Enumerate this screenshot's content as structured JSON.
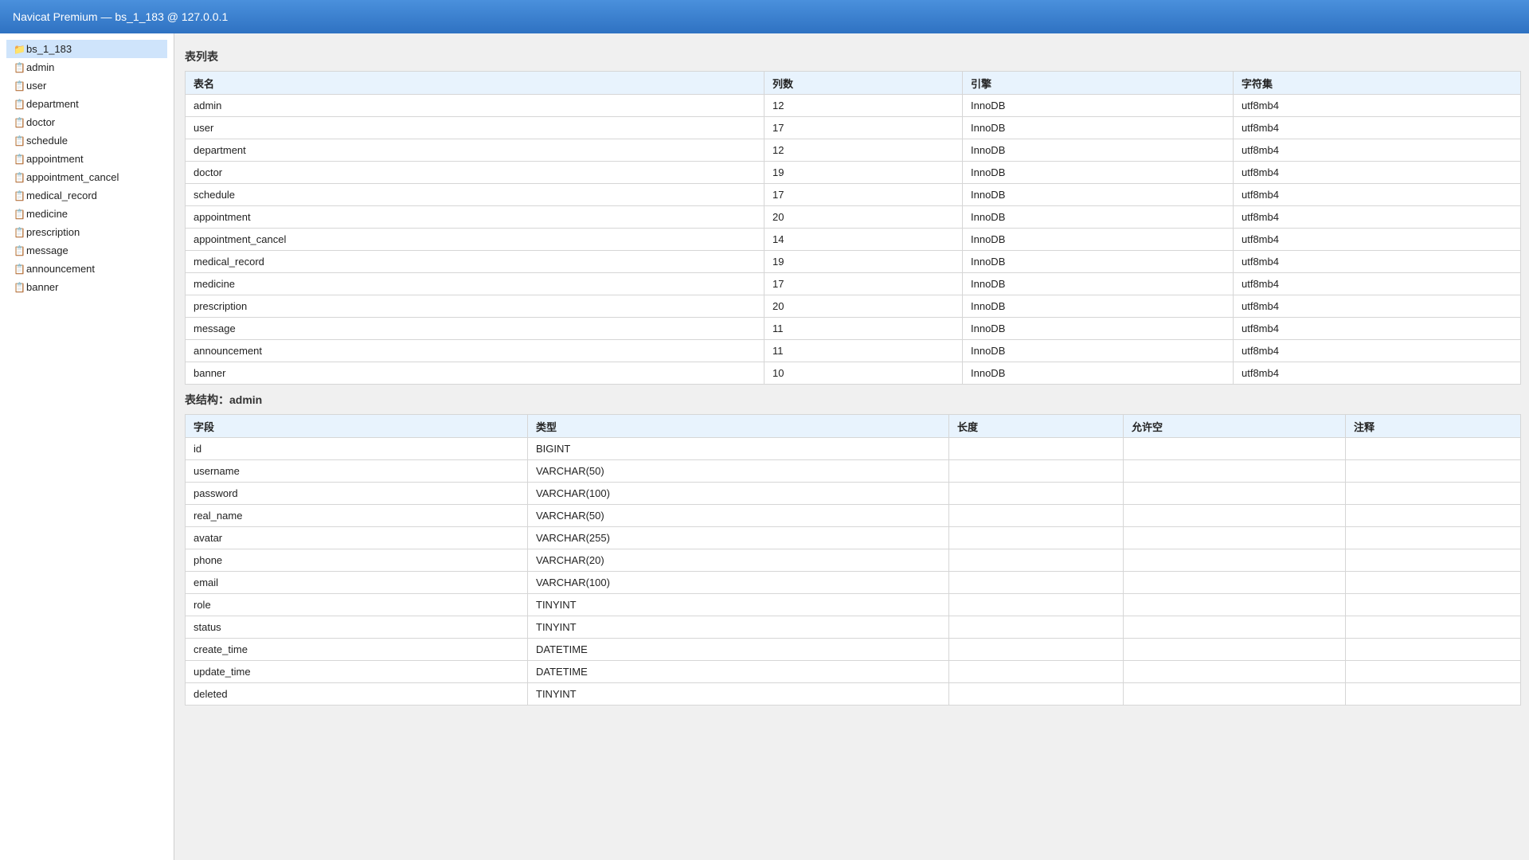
{
  "window": {
    "title": "Navicat Premium — bs_1_183 @ 127.0.0.1"
  },
  "sidebar": {
    "items": [
      {
        "label": "bs_1_183",
        "icon": "folder-icon",
        "selected": true
      },
      {
        "label": "admin",
        "icon": "table-icon"
      },
      {
        "label": "user",
        "icon": "table-icon"
      },
      {
        "label": "department",
        "icon": "table-icon"
      },
      {
        "label": "doctor",
        "icon": "table-icon"
      },
      {
        "label": "schedule",
        "icon": "table-icon"
      },
      {
        "label": "appointment",
        "icon": "table-icon"
      },
      {
        "label": "appointment_cancel",
        "icon": "table-icon"
      },
      {
        "label": "medical_record",
        "icon": "table-icon"
      },
      {
        "label": "medicine",
        "icon": "table-icon"
      },
      {
        "label": "prescription",
        "icon": "table-icon"
      },
      {
        "label": "message",
        "icon": "table-icon"
      },
      {
        "label": "announcement",
        "icon": "table-icon"
      },
      {
        "label": "banner",
        "icon": "table-icon"
      }
    ]
  },
  "table_list": {
    "title": "表列表",
    "headers": [
      "表名",
      "列数",
      "引擎",
      "字符集"
    ],
    "rows": [
      [
        "admin",
        "12",
        "InnoDB",
        "utf8mb4"
      ],
      [
        "user",
        "17",
        "InnoDB",
        "utf8mb4"
      ],
      [
        "department",
        "12",
        "InnoDB",
        "utf8mb4"
      ],
      [
        "doctor",
        "19",
        "InnoDB",
        "utf8mb4"
      ],
      [
        "schedule",
        "17",
        "InnoDB",
        "utf8mb4"
      ],
      [
        "appointment",
        "20",
        "InnoDB",
        "utf8mb4"
      ],
      [
        "appointment_cancel",
        "14",
        "InnoDB",
        "utf8mb4"
      ],
      [
        "medical_record",
        "19",
        "InnoDB",
        "utf8mb4"
      ],
      [
        "medicine",
        "17",
        "InnoDB",
        "utf8mb4"
      ],
      [
        "prescription",
        "20",
        "InnoDB",
        "utf8mb4"
      ],
      [
        "message",
        "11",
        "InnoDB",
        "utf8mb4"
      ],
      [
        "announcement",
        "11",
        "InnoDB",
        "utf8mb4"
      ],
      [
        "banner",
        "10",
        "InnoDB",
        "utf8mb4"
      ]
    ]
  },
  "structure": {
    "title": "表结构：admin",
    "headers": [
      "字段",
      "类型",
      "长度",
      "允许空",
      "注释"
    ],
    "rows": [
      [
        "id",
        "BIGINT",
        "",
        "",
        ""
      ],
      [
        "username",
        "VARCHAR(50)",
        "",
        "",
        ""
      ],
      [
        "password",
        "VARCHAR(100)",
        "",
        "",
        ""
      ],
      [
        "real_name",
        "VARCHAR(50)",
        "",
        "",
        ""
      ],
      [
        "avatar",
        "VARCHAR(255)",
        "",
        "",
        ""
      ],
      [
        "phone",
        "VARCHAR(20)",
        "",
        "",
        ""
      ],
      [
        "email",
        "VARCHAR(100)",
        "",
        "",
        ""
      ],
      [
        "role",
        "TINYINT",
        "",
        "",
        ""
      ],
      [
        "status",
        "TINYINT",
        "",
        "",
        ""
      ],
      [
        "create_time",
        "DATETIME",
        "",
        "",
        ""
      ],
      [
        "update_time",
        "DATETIME",
        "",
        "",
        ""
      ],
      [
        "deleted",
        "TINYINT",
        "",
        "",
        ""
      ]
    ]
  },
  "colors": {
    "titlebar": "#3a82d0",
    "selected": "#cfe4fb",
    "header": "#e8f3fd"
  }
}
